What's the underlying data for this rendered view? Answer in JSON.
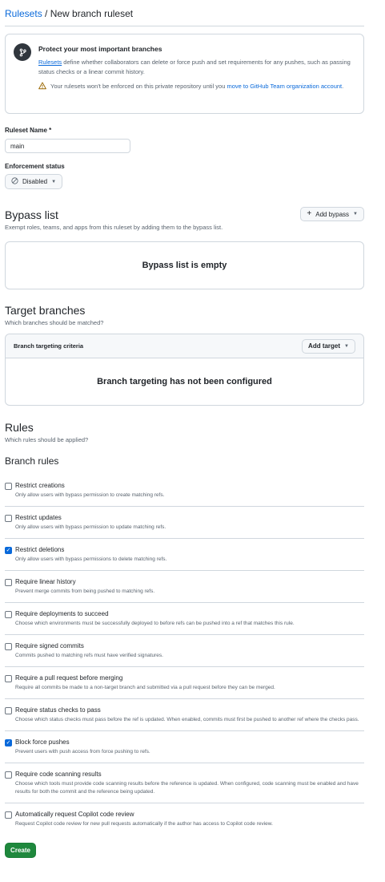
{
  "breadcrumb": {
    "link": "Rulesets",
    "separator": " / ",
    "current": "New branch ruleset"
  },
  "notice": {
    "title": "Protect your most important branches",
    "desc_link": "Rulesets",
    "desc_text": " define whether collaborators can delete or force push and set requirements for any pushes, such as passing status checks or a linear commit history.",
    "warning_text": "Your rulesets won't be enforced on this private repository until you ",
    "warning_link": "move to GitHub Team organization account",
    "warning_end": "."
  },
  "ruleset_name": {
    "label": "Ruleset Name *",
    "value": "main"
  },
  "enforcement": {
    "label": "Enforcement status",
    "value": "Disabled"
  },
  "bypass": {
    "title": "Bypass list",
    "subtitle": "Exempt roles, teams, and apps from this ruleset by adding them to the bypass list.",
    "add_button": "Add bypass",
    "empty": "Bypass list is empty"
  },
  "targets": {
    "title": "Target branches",
    "subtitle": "Which branches should be matched?",
    "criteria_label": "Branch targeting criteria",
    "add_button": "Add target",
    "empty": "Branch targeting has not been configured"
  },
  "rules": {
    "title": "Rules",
    "subtitle": "Which rules should be applied?",
    "branch_rules_title": "Branch rules",
    "items": [
      {
        "name": "Restrict creations",
        "desc": "Only allow users with bypass permission to create matching refs.",
        "checked": false
      },
      {
        "name": "Restrict updates",
        "desc": "Only allow users with bypass permission to update matching refs.",
        "checked": false
      },
      {
        "name": "Restrict deletions",
        "desc": "Only allow users with bypass permissions to delete matching refs.",
        "checked": true
      },
      {
        "name": "Require linear history",
        "desc": "Prevent merge commits from being pushed to matching refs.",
        "checked": false
      },
      {
        "name": "Require deployments to succeed",
        "desc": "Choose which environments must be successfully deployed to before refs can be pushed into a ref that matches this rule.",
        "checked": false
      },
      {
        "name": "Require signed commits",
        "desc": "Commits pushed to matching refs must have verified signatures.",
        "checked": false
      },
      {
        "name": "Require a pull request before merging",
        "desc": "Require all commits be made to a non-target branch and submitted via a pull request before they can be merged.",
        "checked": false
      },
      {
        "name": "Require status checks to pass",
        "desc": "Choose which status checks must pass before the ref is updated. When enabled, commits must first be pushed to another ref where the checks pass.",
        "checked": false
      },
      {
        "name": "Block force pushes",
        "desc": "Prevent users with push access from force pushing to refs.",
        "checked": true
      },
      {
        "name": "Require code scanning results",
        "desc": "Choose which tools must provide code scanning results before the reference is updated. When configured, code scanning must be enabled and have results for both the commit and the reference being updated.",
        "checked": false
      },
      {
        "name": "Automatically request Copilot code review",
        "desc": "Request Copilot code review for new pull requests automatically if the author has access to Copilot code review.",
        "checked": false
      }
    ]
  },
  "create_button": "Create",
  "colors": {
    "link": "#0969da",
    "primary": "#1f883d",
    "warning": "#9a6700"
  }
}
